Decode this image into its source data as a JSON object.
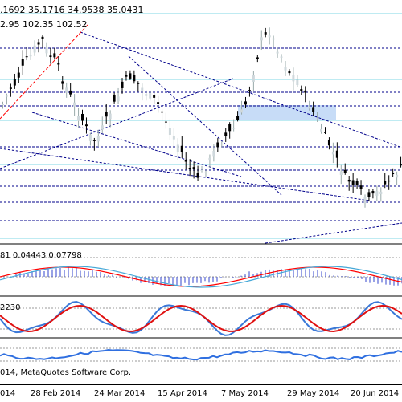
{
  "main_chart": {
    "ohlc_header": ".1692 35.1716 34.9538 35.0431",
    "indicator_header": "2.95 102.35 102.52",
    "colors": {
      "grid": "#00008b",
      "level_cyan": "#7fd7e6",
      "bull_candle": "#cfd8dc",
      "bear_candle": "#000000",
      "zone": "#c7dcf7",
      "trendline_red": "#ff0000"
    }
  },
  "macd_panel": {
    "header": "81  0.04443  0.07798",
    "colors": {
      "hist": "#3344cc",
      "signal": "#ff0000",
      "main": "#45a8d8"
    }
  },
  "stoch_panel": {
    "header": "2230",
    "colors": {
      "k": "#3a78d8",
      "d": "#e01010"
    }
  },
  "rsi_panel": {
    "colors": {
      "line": "#2f6fe0"
    }
  },
  "copyright": "014, MetaQuotes Software Corp.",
  "time_axis": {
    "labels": [
      "014",
      "28 Feb 2014",
      "24 Mar 2014",
      "15 Apr 2014",
      "7 May 2014",
      "29 May 2014",
      "20 Jun 2014"
    ]
  }
}
